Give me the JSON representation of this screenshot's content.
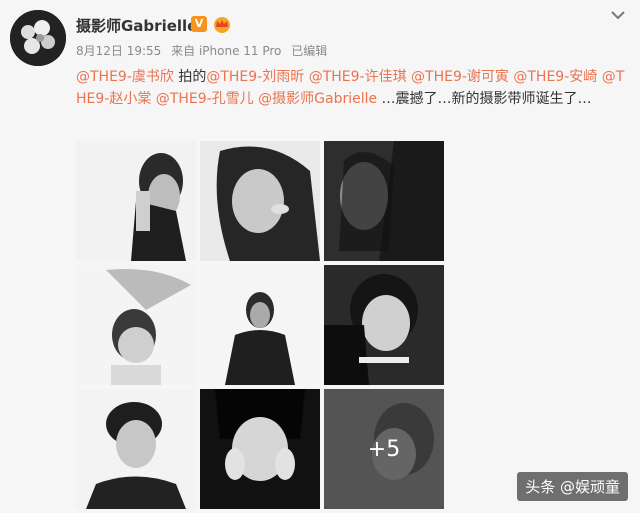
{
  "post": {
    "username": "摄影师Gabrielle",
    "verified_badge": "V",
    "crown_icon": "crown-icon",
    "date": "8月12日 19:55",
    "source": "来自 iPhone 11 Pro",
    "edited": "已编辑",
    "mentions": [
      "@THE9-虞书欣",
      "@THE9-刘雨昕",
      "@THE9-许佳琪",
      "@THE9-谢可寅",
      "@THE9-安崎",
      "@THE9-赵小棠",
      "@THE9-孔雪儿",
      "@摄影师Gabrielle"
    ],
    "text_after_first": " 拍的",
    "text_tail": " …震撼了…新的摄影带师诞生了…",
    "more_count": "+5"
  },
  "watermark": "头条 @娱顽童",
  "colors": {
    "mention": "#eb7350",
    "badge": "#f7941d",
    "text": "#333333",
    "meta": "#8a8a8a"
  }
}
